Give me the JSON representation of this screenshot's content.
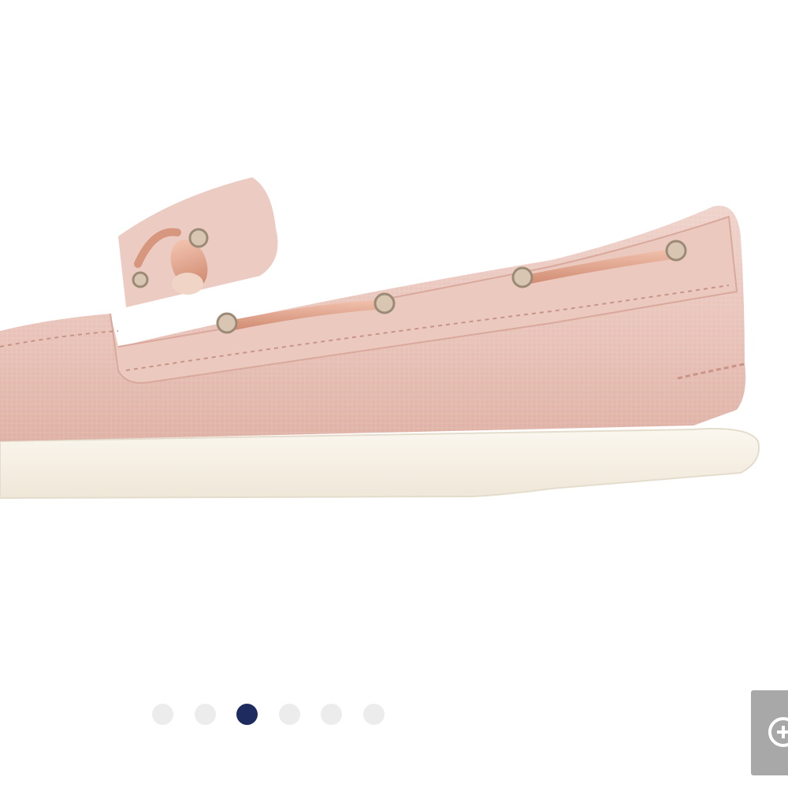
{
  "product_gallery": {
    "image_subject": "shoe-photo",
    "colors": {
      "upper": "#e9c3b9",
      "sole": "#f7f1e6",
      "lace": "#e6a48c",
      "active_dot": "#1e2b5e",
      "inactive_dot": "#ececec",
      "zoom_button": "#a8a8a8"
    },
    "carousel": {
      "total_slides": 6,
      "active_slide": 3
    },
    "zoom": {
      "icon": "zoom-in-icon"
    }
  }
}
